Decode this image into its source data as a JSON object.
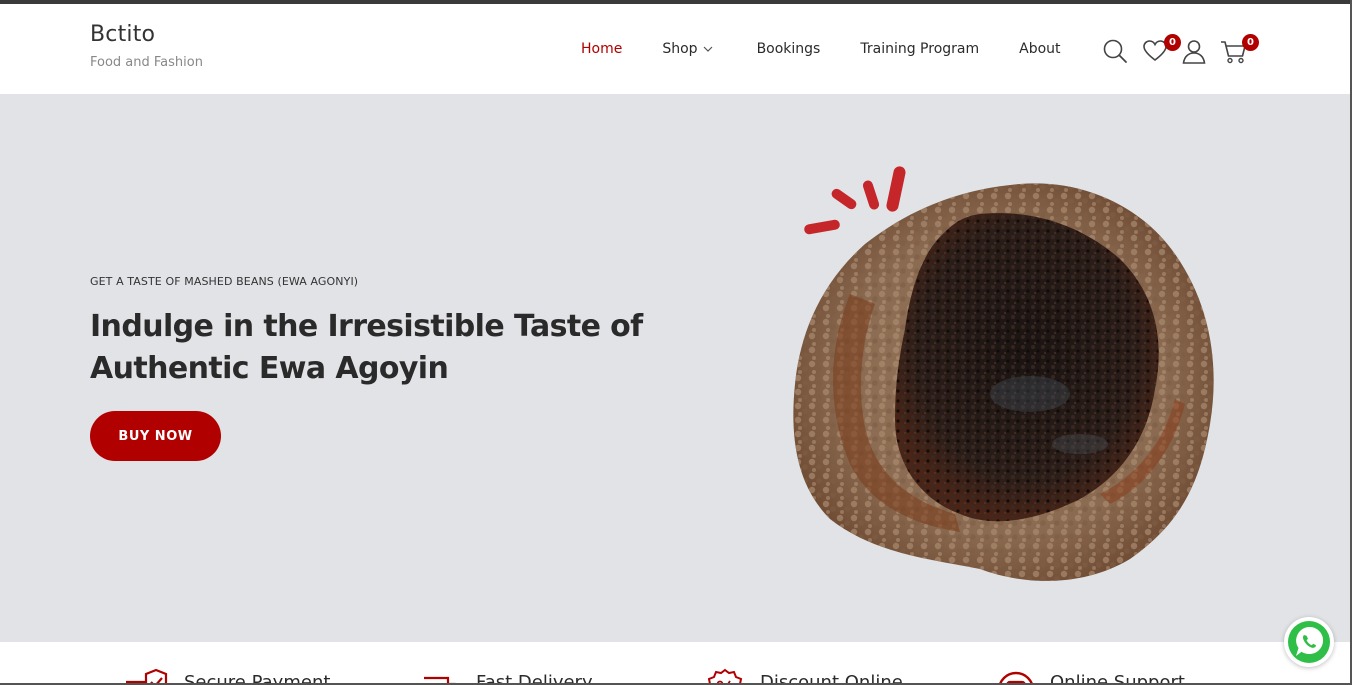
{
  "brand": {
    "name": "Bctito",
    "tagline": "Food and Fashion"
  },
  "nav": [
    {
      "label": "Home",
      "active": true
    },
    {
      "label": "Shop",
      "dropdown": true
    },
    {
      "label": "Bookings"
    },
    {
      "label": "Training Program"
    },
    {
      "label": "About"
    }
  ],
  "header_icons": {
    "search": "search-icon",
    "wishlist": "heart-icon",
    "wishlist_count": "0",
    "account": "user-icon",
    "cart": "cart-icon",
    "cart_count": "0"
  },
  "hero": {
    "eyebrow": "GET A TASTE OF MASHED BEANS (EWA AGONYI)",
    "headline_line1": "Indulge in the Irresistible Taste of",
    "headline_line2": "Authentic Ewa Agoyin",
    "cta": "BUY NOW"
  },
  "features": [
    {
      "label": "Secure Payment",
      "icon": "shield-check-icon"
    },
    {
      "label": "Fast Delivery",
      "icon": "truck-icon"
    },
    {
      "label": "Discount Online",
      "icon": "discount-badge-icon"
    },
    {
      "label": "Online Support",
      "icon": "support-icon"
    }
  ],
  "whatsapp": {
    "icon": "whatsapp-icon"
  },
  "colors": {
    "accent": "#b00000",
    "hero_bg": "#e1e3e6",
    "text": "#2a2a2a"
  }
}
